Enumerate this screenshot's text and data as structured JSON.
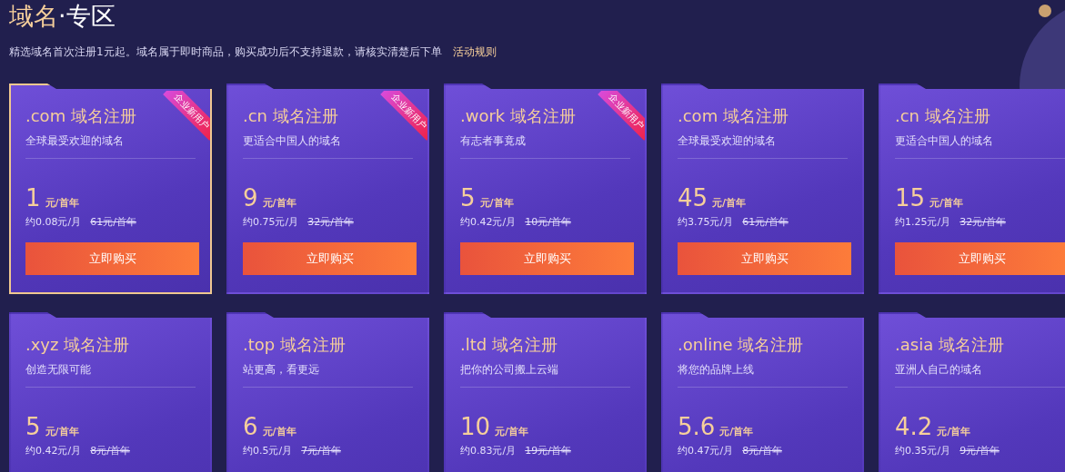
{
  "header": {
    "title_highlight": "域名",
    "title_rest": "·专区",
    "notice": "精选域名首次注册1元起。域名属于即时商品，购买成功后不支持退款，请核实清楚后下单",
    "rules_link": "活动规则"
  },
  "cards": [
    {
      "title": ".com 域名注册",
      "desc": "全球最受欢迎的域名",
      "price": "1",
      "unit": "元/首年",
      "monthly": "约0.08元/月",
      "original": "61元/首年",
      "button": "立即购买",
      "badge": "企业新用户",
      "selected": true
    },
    {
      "title": ".cn 域名注册",
      "desc": "更适合中国人的域名",
      "price": "9",
      "unit": "元/首年",
      "monthly": "约0.75元/月",
      "original": "32元/首年",
      "button": "立即购买",
      "badge": "企业新用户",
      "selected": false
    },
    {
      "title": ".work 域名注册",
      "desc": "有志者事竟成",
      "price": "5",
      "unit": "元/首年",
      "monthly": "约0.42元/月",
      "original": "10元/首年",
      "button": "立即购买",
      "badge": "企业新用户",
      "selected": false
    },
    {
      "title": ".com 域名注册",
      "desc": "全球最受欢迎的域名",
      "price": "45",
      "unit": "元/首年",
      "monthly": "约3.75元/月",
      "original": "61元/首年",
      "button": "立即购买",
      "selected": false
    },
    {
      "title": ".cn 域名注册",
      "desc": "更适合中国人的域名",
      "price": "15",
      "unit": "元/首年",
      "monthly": "约1.25元/月",
      "original": "32元/首年",
      "button": "立即购买",
      "selected": false
    },
    {
      "title": ".xyz 域名注册",
      "desc": "创造无限可能",
      "price": "5",
      "unit": "元/首年",
      "monthly": "约0.42元/月",
      "original": "8元/首年",
      "selected": false
    },
    {
      "title": ".top 域名注册",
      "desc": "站更高，看更远",
      "price": "6",
      "unit": "元/首年",
      "monthly": "约0.5元/月",
      "original": "7元/首年",
      "selected": false
    },
    {
      "title": ".ltd 域名注册",
      "desc": "把你的公司搬上云端",
      "price": "10",
      "unit": "元/首年",
      "monthly": "约0.83元/月",
      "original": "19元/首年",
      "selected": false
    },
    {
      "title": ".online 域名注册",
      "desc": "将您的品牌上线",
      "price": "5.6",
      "unit": "元/首年",
      "monthly": "约0.47元/月",
      "original": "8元/首年",
      "selected": false
    },
    {
      "title": ".asia 域名注册",
      "desc": "亚洲人自己的域名",
      "price": "4.2",
      "unit": "元/首年",
      "monthly": "约0.35元/月",
      "original": "9元/首年",
      "selected": false
    }
  ]
}
